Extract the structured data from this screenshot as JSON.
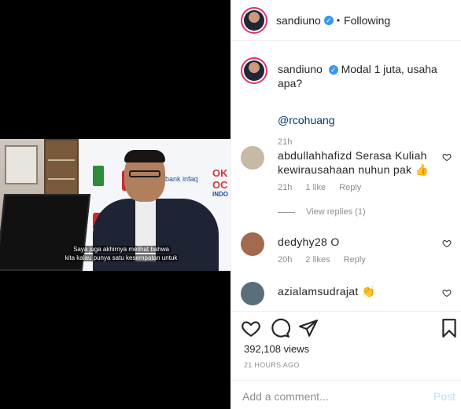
{
  "post": {
    "username": "sandiuno",
    "following_label": "Following",
    "caption": "Modal 1 juta, usaha apa?",
    "mention": "@rcohuang",
    "caption_time": "21h"
  },
  "video": {
    "subtitle_line1": "Saya juga akhirnya melihat bahwa",
    "subtitle_line2": "kita kalau punya satu kesempatan untuk",
    "banner_bank": "bank infaq",
    "banner_oko": "OK OC",
    "banner_indo": "INDO"
  },
  "comments": [
    {
      "user": "abdullahhafizd",
      "text": "Serasa Kuliah kewirausahaan nuhun pak 👍",
      "time": "21h",
      "likes": "1 like",
      "reply": "Reply",
      "view_replies": "View replies (1)",
      "avatar_color": "#c7b9a4"
    },
    {
      "user": "dedyhy28",
      "text": "O",
      "time": "20h",
      "likes": "2 likes",
      "reply": "Reply",
      "avatar_color": "#a36a4f"
    },
    {
      "user": "azialamsudrajat",
      "text": "👏",
      "time": "",
      "likes": "",
      "reply": "",
      "avatar_color": "#5a6e7a"
    }
  ],
  "stats": {
    "views": "392,108 views",
    "ago": "21 HOURS AGO"
  },
  "composer": {
    "placeholder": "Add a comment...",
    "post_label": "Post"
  },
  "colors": {
    "verified": "#3897f0",
    "link": "#00376b",
    "muted": "#8e8e8e",
    "post_disabled": "#b2dffc"
  }
}
